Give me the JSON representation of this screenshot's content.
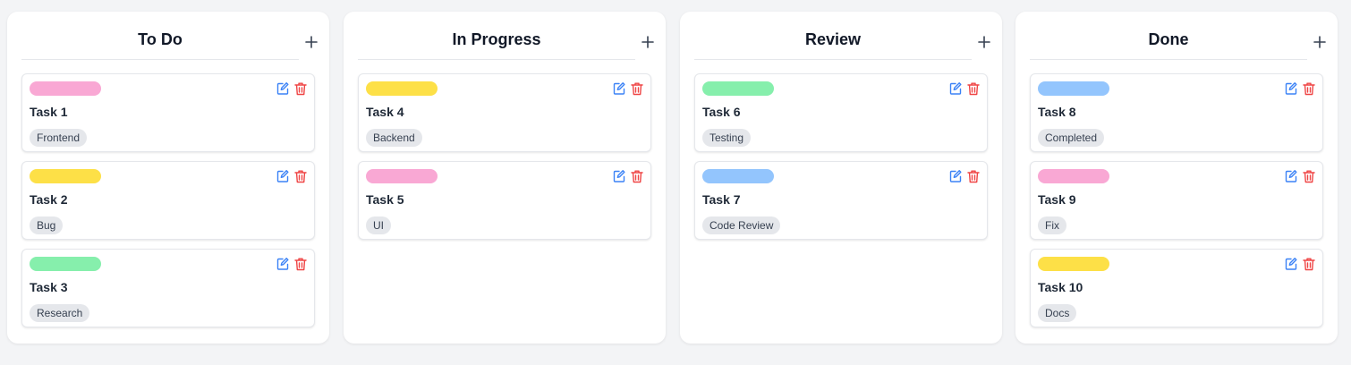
{
  "colors": {
    "pink": "#f9a8d4",
    "yellow": "#fde047",
    "green": "#86efac",
    "blue": "#93c5fd",
    "edit_icon": "#3b82f6",
    "delete_icon": "#ef4444",
    "tag_bg": "#e5e7eb",
    "page_bg": "#f3f4f6"
  },
  "icons": {
    "add": "plus-icon",
    "edit": "edit-icon",
    "delete": "trash-icon"
  },
  "columns": [
    {
      "title": "To Do",
      "cards": [
        {
          "title": "Task 1",
          "tag": "Frontend",
          "color": "#f9a8d4"
        },
        {
          "title": "Task 2",
          "tag": "Bug",
          "color": "#fde047"
        },
        {
          "title": "Task 3",
          "tag": "Research",
          "color": "#86efac"
        }
      ]
    },
    {
      "title": "In Progress",
      "cards": [
        {
          "title": "Task 4",
          "tag": "Backend",
          "color": "#fde047"
        },
        {
          "title": "Task 5",
          "tag": "UI",
          "color": "#f9a8d4"
        }
      ]
    },
    {
      "title": "Review",
      "cards": [
        {
          "title": "Task 6",
          "tag": "Testing",
          "color": "#86efac"
        },
        {
          "title": "Task 7",
          "tag": "Code Review",
          "color": "#93c5fd"
        }
      ]
    },
    {
      "title": "Done",
      "cards": [
        {
          "title": "Task 8",
          "tag": "Completed",
          "color": "#93c5fd"
        },
        {
          "title": "Task 9",
          "tag": "Fix",
          "color": "#f9a8d4"
        },
        {
          "title": "Task 10",
          "tag": "Docs",
          "color": "#fde047"
        }
      ]
    }
  ]
}
